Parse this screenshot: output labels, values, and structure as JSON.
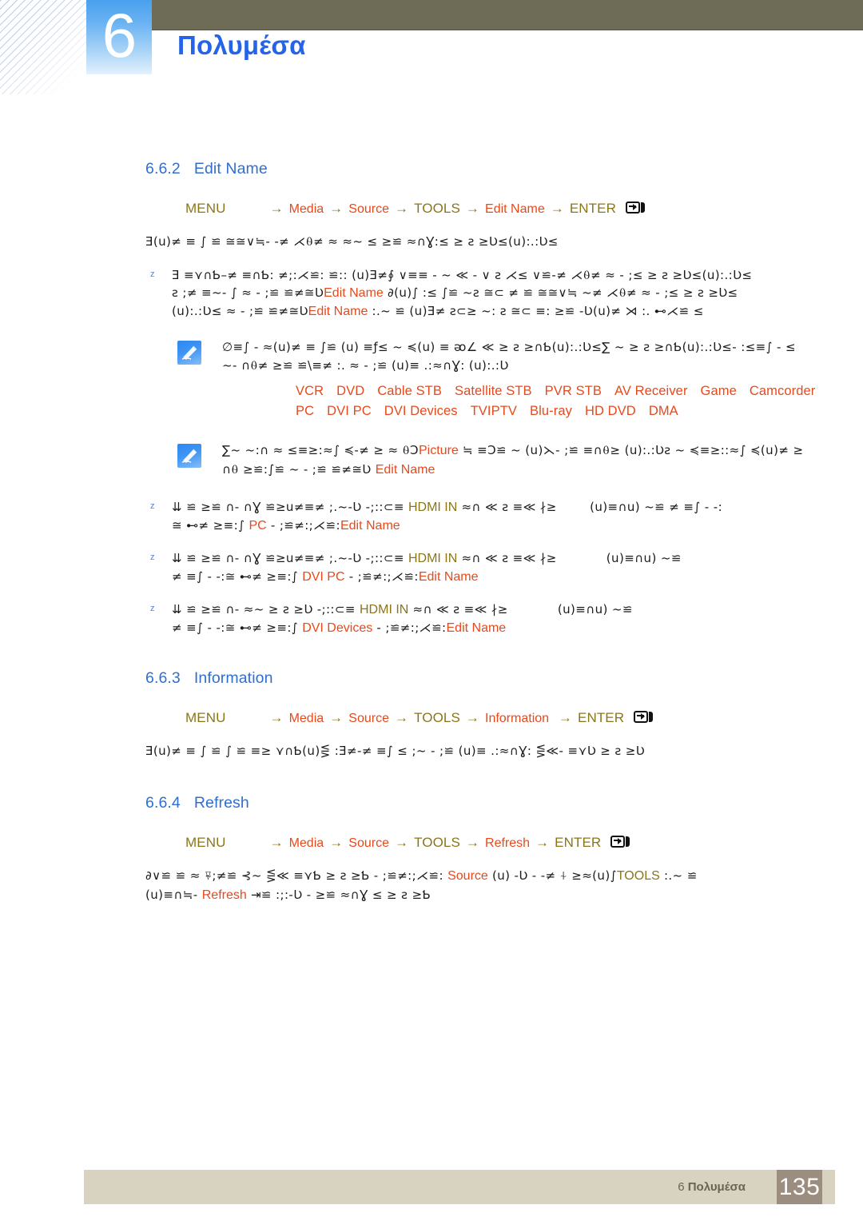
{
  "header": {
    "chapter_number": "6",
    "chapter_title": "Πολυμέσα",
    "accent_blue": "#2563e8",
    "olive_bar_color": "#6e6b56"
  },
  "sections": [
    {
      "number": "6.6.2",
      "title": "Edit Name",
      "menu_path": {
        "root": "MENU",
        "steps": [
          "Media",
          "Source",
          "TOOLS",
          "Edit Name",
          "ENTER"
        ],
        "enter_icon": "enter-key-icon",
        "arrow": "→"
      },
      "lead": "Ǝ(u)≠ ≡ ∫   ≌   ≅≅∨≒- -≠ ⋌⍬≠ ≈  ≈~ ≤  ≥≌      ≈∩Ɣ:≤  ≥  ꙅ ≥Ʋ≤(u):.:Ʋ≤",
      "bullets": [
        {
          "marker": "z",
          "lines": [
            "Ǝ  ≡⋎∩Ƅ–≠ ≡∩Ƅ:  ≠;:⋌≌:   ≌::  (u)Ǝ≠∮ ∨≡≡ -  ~ ≪ - ∨   ꙅ ⋌≤  ∨≌-≠ ⋌⍬≠ ≈  - ;≤  ≥  ꙅ ≥Ʋ≤(u):.:Ʋ≤",
            "ꙅ ;≠ ≡~-  ∫ ≈ - ;≌  ≌≠≅Ʋ",
            "(u):.:Ʋ≤ ≈ - ;≌  ≌≠≅Ʋ"
          ],
          "inline_tokens": [
            "Edit Name"
          ]
        }
      ],
      "notes": [
        {
          "icon": "note-pen-icon",
          "lines": [
            "∅≡∫ -   ≈(u)≠ ≡ ∫≌ (u) ≡ƒ≤ ~ ≼(u) ≡ ᴔ∠ ≪   ≥ ꙅ ≥∩Ƅ(u):.:Ʋ≤∑ ~    ≥ ꙅ ≥∩Ƅ(u):.:Ʋ≤- :≤≡∫ -  ≤",
            "~- ∩⍬≠ ≥≌ ≌\\≡≠ :.   ≈ - ;≌ (u)≡  .:≈∩Ɣ: (u):.:Ʋ"
          ],
          "device_rows": [
            [
              "VCR",
              "DVD",
              "Cable STB",
              "Satellite STB",
              "PVR STB",
              "AV Receiver",
              "Game",
              "Camcorder"
            ],
            [
              "PC",
              "DVI PC",
              "DVI Devices",
              "TVIPTV",
              "Blu-ray",
              "HD DVD",
              "DMA"
            ]
          ]
        },
        {
          "icon": "note-pen-icon",
          "lines": [
            "∑~ ~:∩ ≈ ≤≡≥:≈∫   ≼-≠ ≥ ≈ ⍬Ͻ",
            "∩⍬ ≥≌:∫≌ ~ - ;≌  ≌≠≅Ʋ"
          ],
          "inline_tokens": [
            "Picture",
            "Edit Name"
          ]
        }
      ],
      "device_bullets": [
        {
          "marker": "z",
          "line1_pre": "⇊  ≌  ≥≌ ∩-  ∩Ɣ ≌≥u≠≡≠ ;.~-Ʋ -;::⊂≡",
          "olive_token": "HDMI IN",
          "line1_post": "≈∩ ≪ ꙅ ≡≪ ∤≥",
          "line1_tail": "(u)≡∩u) ~≌ ≠ ≡∫ - -:",
          "line2_pre": "≅ ⊷≠ ≥≡:∫",
          "orange_token": "PC",
          "line2_mid": "- ;≌≠:;⋌≌:",
          "orange_token2": "Edit Name"
        },
        {
          "marker": "z",
          "line1_pre": "⇊  ≌  ≥≌ ∩-  ∩Ɣ ≌≥u≠≡≠ ;.~-Ʋ -;::⊂≡",
          "olive_token": "HDMI IN",
          "line1_post": "≈∩ ≪ ꙅ ≡≪ ∤≥",
          "line1_tail": "(u)≡∩u) ~≌",
          "line2_pre": "≠ ≡∫ - -:≅ ⊷≠ ≥≡:∫",
          "orange_token": "DVI PC",
          "line2_mid": "- ;≌≠:;⋌≌:",
          "orange_token2": "Edit Name"
        },
        {
          "marker": "z",
          "line1_pre": "⇊  ≌  ≥≌ ∩-  ≈~  ≥ ꙅ ≥Ʋ      -;::⊂≡",
          "olive_token": "HDMI IN",
          "line1_post": "≈∩ ≪ ꙅ ≡≪ ∤≥",
          "line1_tail": "(u)≡∩u) ~≌",
          "line2_pre": "≠ ≡∫ - -:≅ ⊷≠ ≥≡:∫",
          "orange_token": "DVI Devices",
          "line2_mid": "- ;≌≠:;⋌≌:",
          "orange_token2": "Edit Name"
        }
      ]
    },
    {
      "number": "6.6.3",
      "title": "Information",
      "menu_path": {
        "root": "MENU",
        "steps": [
          "Media",
          "Source",
          "TOOLS",
          "Information",
          "ENTER"
        ],
        "enter_icon": "enter-key-icon",
        "arrow": "→"
      },
      "lead": "Ǝ(u)≠ ≡ ∫   ≌    ∫    ≌ ≡≥ ⋎∩Ƅ(u)⋚ :Ǝ≠-≠ ≡∫ ≤ ;~ - ;≌ (u)≡  .:≈∩Ɣ:  ⋚≪- ≡⋎Ʋ  ≥ ꙅ ≥Ʋ"
    },
    {
      "number": "6.6.4",
      "title": "Refresh",
      "menu_path": {
        "root": "MENU",
        "steps": [
          "Media",
          "Source",
          "TOOLS",
          "Refresh",
          "ENTER"
        ],
        "enter_icon": "enter-key-icon",
        "arrow": "→"
      },
      "body_line1_pre": "∂∨≌  ≌ ≈  ⍫;≠≌ ⊰~ ⋚≪ ≡⋎Ƅ ≥ ꙅ ≥Ƅ  - ;≌≠:;⋌≌:",
      "body_token1": "Source",
      "body_line1_mid": "(u) -Ʋ -  -≠ ⍭ ≥≈(u)∫",
      "body_token2": "TOOLS",
      "body_line1_post": ":.~ ≌",
      "body_line2_pre": "(u)≡∩≒-",
      "body_token3": "Refresh",
      "body_line2_post": "⇥≌ :;:-Ʋ -     ≥≌     ≈∩Ɣ ≤  ≥ ꙅ ≥Ƅ"
    }
  ],
  "footer": {
    "chapter_ref_number": "6",
    "chapter_ref_title": "Πολυμέσα",
    "page_number": "135",
    "bar_color": "#d8d3c0",
    "page_box_color": "#9b8d80"
  },
  "colors": {
    "heading_blue": "#2f6fd0",
    "menu_olive": "#8a7619",
    "highlight_orange": "#e8491b"
  }
}
